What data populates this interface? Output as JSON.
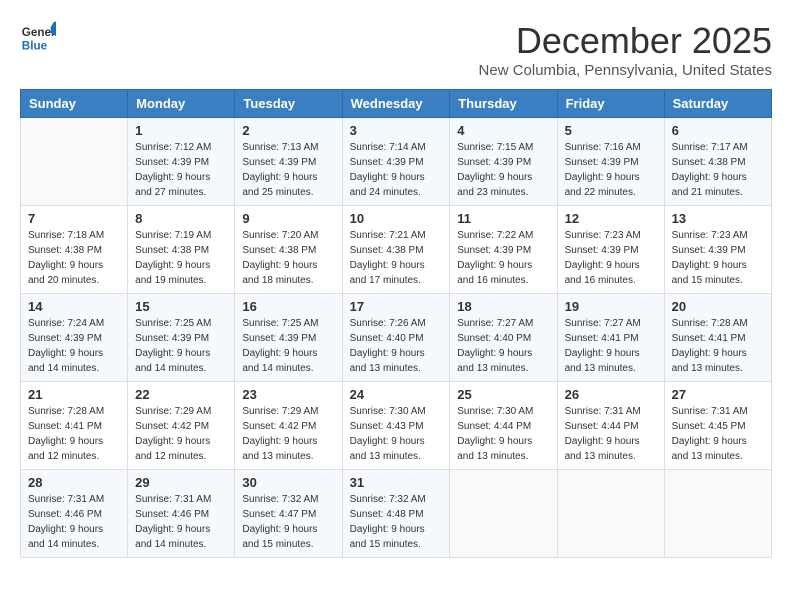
{
  "header": {
    "logo_line1": "General",
    "logo_line2": "Blue",
    "month_title": "December 2025",
    "location": "New Columbia, Pennsylvania, United States"
  },
  "weekdays": [
    "Sunday",
    "Monday",
    "Tuesday",
    "Wednesday",
    "Thursday",
    "Friday",
    "Saturday"
  ],
  "weeks": [
    [
      {
        "day": "",
        "sunrise": "",
        "sunset": "",
        "daylight": ""
      },
      {
        "day": "1",
        "sunrise": "7:12 AM",
        "sunset": "4:39 PM",
        "daylight": "9 hours and 27 minutes."
      },
      {
        "day": "2",
        "sunrise": "7:13 AM",
        "sunset": "4:39 PM",
        "daylight": "9 hours and 25 minutes."
      },
      {
        "day": "3",
        "sunrise": "7:14 AM",
        "sunset": "4:39 PM",
        "daylight": "9 hours and 24 minutes."
      },
      {
        "day": "4",
        "sunrise": "7:15 AM",
        "sunset": "4:39 PM",
        "daylight": "9 hours and 23 minutes."
      },
      {
        "day": "5",
        "sunrise": "7:16 AM",
        "sunset": "4:39 PM",
        "daylight": "9 hours and 22 minutes."
      },
      {
        "day": "6",
        "sunrise": "7:17 AM",
        "sunset": "4:38 PM",
        "daylight": "9 hours and 21 minutes."
      }
    ],
    [
      {
        "day": "7",
        "sunrise": "7:18 AM",
        "sunset": "4:38 PM",
        "daylight": "9 hours and 20 minutes."
      },
      {
        "day": "8",
        "sunrise": "7:19 AM",
        "sunset": "4:38 PM",
        "daylight": "9 hours and 19 minutes."
      },
      {
        "day": "9",
        "sunrise": "7:20 AM",
        "sunset": "4:38 PM",
        "daylight": "9 hours and 18 minutes."
      },
      {
        "day": "10",
        "sunrise": "7:21 AM",
        "sunset": "4:38 PM",
        "daylight": "9 hours and 17 minutes."
      },
      {
        "day": "11",
        "sunrise": "7:22 AM",
        "sunset": "4:39 PM",
        "daylight": "9 hours and 16 minutes."
      },
      {
        "day": "12",
        "sunrise": "7:23 AM",
        "sunset": "4:39 PM",
        "daylight": "9 hours and 16 minutes."
      },
      {
        "day": "13",
        "sunrise": "7:23 AM",
        "sunset": "4:39 PM",
        "daylight": "9 hours and 15 minutes."
      }
    ],
    [
      {
        "day": "14",
        "sunrise": "7:24 AM",
        "sunset": "4:39 PM",
        "daylight": "9 hours and 14 minutes."
      },
      {
        "day": "15",
        "sunrise": "7:25 AM",
        "sunset": "4:39 PM",
        "daylight": "9 hours and 14 minutes."
      },
      {
        "day": "16",
        "sunrise": "7:25 AM",
        "sunset": "4:39 PM",
        "daylight": "9 hours and 14 minutes."
      },
      {
        "day": "17",
        "sunrise": "7:26 AM",
        "sunset": "4:40 PM",
        "daylight": "9 hours and 13 minutes."
      },
      {
        "day": "18",
        "sunrise": "7:27 AM",
        "sunset": "4:40 PM",
        "daylight": "9 hours and 13 minutes."
      },
      {
        "day": "19",
        "sunrise": "7:27 AM",
        "sunset": "4:41 PM",
        "daylight": "9 hours and 13 minutes."
      },
      {
        "day": "20",
        "sunrise": "7:28 AM",
        "sunset": "4:41 PM",
        "daylight": "9 hours and 13 minutes."
      }
    ],
    [
      {
        "day": "21",
        "sunrise": "7:28 AM",
        "sunset": "4:41 PM",
        "daylight": "9 hours and 12 minutes."
      },
      {
        "day": "22",
        "sunrise": "7:29 AM",
        "sunset": "4:42 PM",
        "daylight": "9 hours and 12 minutes."
      },
      {
        "day": "23",
        "sunrise": "7:29 AM",
        "sunset": "4:42 PM",
        "daylight": "9 hours and 13 minutes."
      },
      {
        "day": "24",
        "sunrise": "7:30 AM",
        "sunset": "4:43 PM",
        "daylight": "9 hours and 13 minutes."
      },
      {
        "day": "25",
        "sunrise": "7:30 AM",
        "sunset": "4:44 PM",
        "daylight": "9 hours and 13 minutes."
      },
      {
        "day": "26",
        "sunrise": "7:31 AM",
        "sunset": "4:44 PM",
        "daylight": "9 hours and 13 minutes."
      },
      {
        "day": "27",
        "sunrise": "7:31 AM",
        "sunset": "4:45 PM",
        "daylight": "9 hours and 13 minutes."
      }
    ],
    [
      {
        "day": "28",
        "sunrise": "7:31 AM",
        "sunset": "4:46 PM",
        "daylight": "9 hours and 14 minutes."
      },
      {
        "day": "29",
        "sunrise": "7:31 AM",
        "sunset": "4:46 PM",
        "daylight": "9 hours and 14 minutes."
      },
      {
        "day": "30",
        "sunrise": "7:32 AM",
        "sunset": "4:47 PM",
        "daylight": "9 hours and 15 minutes."
      },
      {
        "day": "31",
        "sunrise": "7:32 AM",
        "sunset": "4:48 PM",
        "daylight": "9 hours and 15 minutes."
      },
      {
        "day": "",
        "sunrise": "",
        "sunset": "",
        "daylight": ""
      },
      {
        "day": "",
        "sunrise": "",
        "sunset": "",
        "daylight": ""
      },
      {
        "day": "",
        "sunrise": "",
        "sunset": "",
        "daylight": ""
      }
    ]
  ],
  "labels": {
    "sunrise_prefix": "Sunrise: ",
    "sunset_prefix": "Sunset: ",
    "daylight_prefix": "Daylight: "
  }
}
